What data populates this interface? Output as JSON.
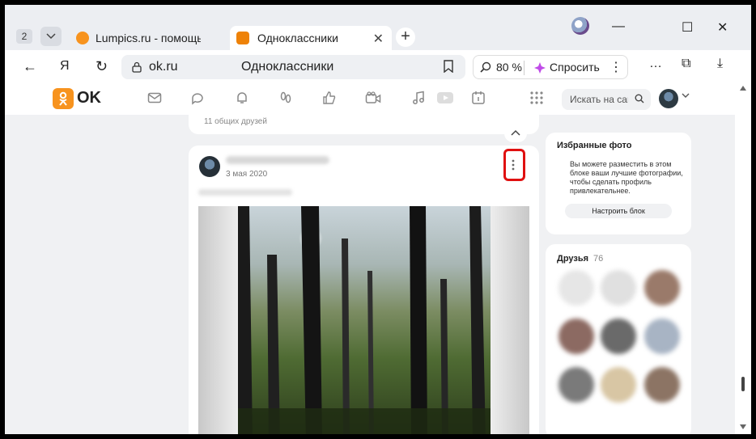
{
  "browser": {
    "tab_count": "2",
    "tabs": [
      {
        "title": "Lumpics.ru - помощь с ком",
        "favicon_color": "#f7931e"
      },
      {
        "title": "Одноклассники",
        "favicon_color": "#ee8208"
      }
    ],
    "address": {
      "host": "ok.ru",
      "page_title": "Одноклассники"
    },
    "zoom": "80 %",
    "ask_label": "Спросить"
  },
  "ok": {
    "logo_text": "OK",
    "search_placeholder": "Искать на сайте",
    "nav_icons": [
      "messages-icon",
      "discussions-icon",
      "notifications-icon",
      "guests-icon",
      "likes-icon",
      "video-calls-icon",
      "music-icon",
      "video-icon",
      "events-icon",
      "apps-grid-icon"
    ]
  },
  "feed": {
    "prev_card_text": "11 общих друзей",
    "post": {
      "date": "3 мая 2020"
    }
  },
  "sidebar": {
    "favorites": {
      "title": "Избранные фото",
      "text": "Вы можете разместить в этом блоке ваши лучшие фотографии, чтобы сделать профиль привлекательнее.",
      "button": "Настроить блок"
    },
    "friends": {
      "title": "Друзья",
      "count": "76"
    }
  },
  "colors": {
    "accent": "#ee8208",
    "highlight": "#e01010"
  }
}
